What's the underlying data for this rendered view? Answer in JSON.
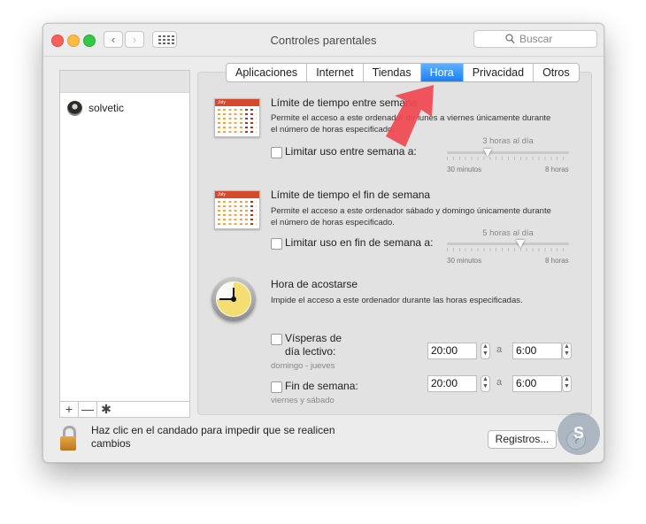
{
  "window": {
    "title": "Controles parentales"
  },
  "search": {
    "placeholder": "Buscar"
  },
  "users": [
    {
      "name": "solvetic"
    }
  ],
  "sidebar_tools": {
    "add": "+",
    "remove": "—",
    "gear": "✱"
  },
  "tabs": [
    {
      "label": "Aplicaciones",
      "active": false
    },
    {
      "label": "Internet",
      "active": false
    },
    {
      "label": "Tiendas",
      "active": false
    },
    {
      "label": "Hora",
      "active": true
    },
    {
      "label": "Privacidad",
      "active": false
    },
    {
      "label": "Otros",
      "active": false
    }
  ],
  "weekday": {
    "calendar_month": "July",
    "title": "Límite de tiempo entre semana",
    "description": "Permite el acceso a este ordenador de lunes a viernes únicamente durante el número de horas especificado.",
    "checkbox_label": "Limitar uso entre semana a:",
    "checked": false,
    "slider_value": "3 horas al día",
    "slider_level_fraction": 0.33,
    "min_label": "30 minutos",
    "max_label": "8 horas"
  },
  "weekend": {
    "calendar_month": "July",
    "title": "Límite de tiempo el fin de semana",
    "description": "Permite el acceso a este ordenador sábado y domingo únicamente durante el número de horas especificado.",
    "checkbox_label": "Limitar uso en fin de semana a:",
    "checked": false,
    "slider_value": "5 horas al día",
    "slider_level_fraction": 0.6,
    "min_label": "30 minutos",
    "max_label": "8 horas"
  },
  "bedtime": {
    "title": "Hora de acostarse",
    "description": "Impide el acceso a este ordenador durante las horas especificadas.",
    "school_nights": {
      "label_line1": "Vísperas de",
      "label_line2": "día lectivo:",
      "sub": "domingo - jueves",
      "from": "20:00",
      "separator": "a",
      "to": "6:00",
      "checked": false
    },
    "weekend": {
      "label": "Fin de semana:",
      "sub": "viernes y sábado",
      "from": "20:00",
      "separator": "a",
      "to": "6:00",
      "checked": false
    }
  },
  "footer": {
    "lock_text": "Haz clic en el candado para impedir que se realicen cambios",
    "logs_button": "Registros...",
    "help_button": "?"
  },
  "colors": {
    "active_tab": "#1b7ff4",
    "arrow": "#f0474f",
    "lock": "#d8952f"
  }
}
